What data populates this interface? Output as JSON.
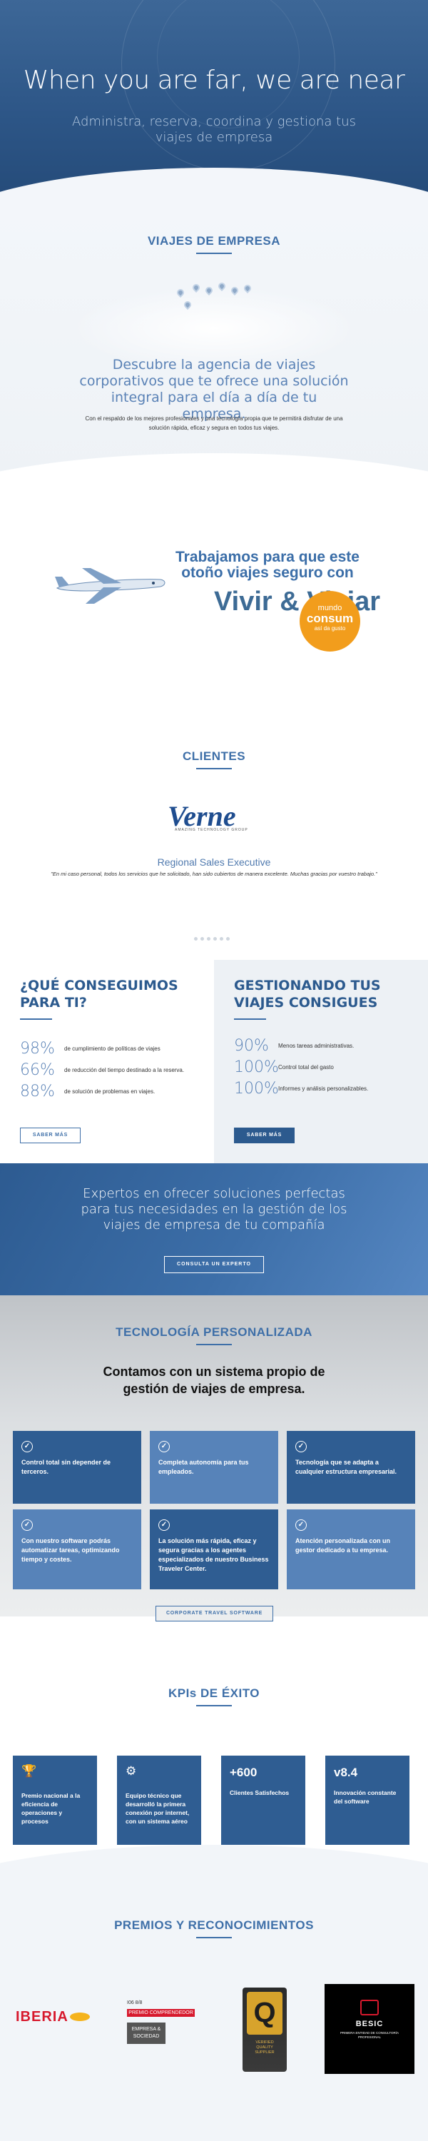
{
  "hero": {
    "title": "When you are far, we are near",
    "subtitle": "Administra, reserva, coordina y gestiona tus viajes de empresa"
  },
  "viajes": {
    "heading": "VIAJES DE EMPRESA",
    "lead": "Descubre la agencia de viajes corporativos que te ofrece una solución integral para el día a día de tu empresa.",
    "body": "Con el respaldo de los mejores profesionales y una tecnología propia que te permitirá disfrutar de una solución rápida, eficaz y segura en todos tus viajes."
  },
  "banner": {
    "line1": "Trabajamos para que este otoño viajes seguro con",
    "line2": "Vivir & Viajar",
    "badge_top": "mundo",
    "badge_brand": "consum",
    "badge_sub": "así da gusto"
  },
  "clientes": {
    "heading": "CLIENTES",
    "logo_text": "Verne",
    "logo_sub": "AMAZING TECHNOLOGY GROUP",
    "role": "Regional Sales Executive",
    "quote": "\"En mi caso personal, todos los servicios que he solicitado, han sido cubiertos de manera excelente. Muchas gracias por vuestro trabajo.\""
  },
  "conseguimos": {
    "heading": "¿QUÉ CONSEGUIMOS PARA TI?",
    "items": [
      {
        "pct": "98%",
        "text": "de cumplimiento de políticas de viajes"
      },
      {
        "pct": "66%",
        "text": "de reducción del tiempo destinado a la reserva."
      },
      {
        "pct": "88%",
        "text": "de solución de problemas en viajes."
      }
    ],
    "button": "SABER MÁS"
  },
  "gestionando": {
    "heading": "GESTIONANDO TUS VIAJES CONSIGUES",
    "items": [
      {
        "pct": "90%",
        "text": "Menos tareas administrativas."
      },
      {
        "pct": "100%",
        "text": "Control total del gasto"
      },
      {
        "pct": "100%",
        "text": "Informes y análisis personalizables."
      }
    ],
    "button": "SABER MÁS"
  },
  "cta": {
    "text": "Expertos en ofrecer soluciones perfectas para tus necesidades en la gestión de los viajes de empresa de tu compañía",
    "button": "CONSULTA UN EXPERTO"
  },
  "tech": {
    "heading": "TECNOLOGÍA PERSONALIZADA",
    "subheading": "Contamos con un sistema propio de gestión de viajes de empresa.",
    "cards": [
      "Control total sin depender de terceros.",
      "Completa autonomía para tus empleados.",
      "Tecnología que se adapta a cualquier estructura empresarial.",
      "Con nuestro software podrás automatizar tareas, optimizando tiempo y costes.",
      "La solución más rápida, eficaz y segura gracias a los agentes especializados de nuestro Business Traveler Center.",
      "Atención personalizada con un gestor dedicado a tu empresa."
    ],
    "button": "CORPORATE TRAVEL SOFTWARE"
  },
  "kpis": {
    "heading": "KPIs DE ÉXITO",
    "items": [
      {
        "big": "",
        "text": "Premio nacional a la eficiencia de operaciones y procesos"
      },
      {
        "big": "",
        "text": "Equipo técnico que desarrolló la primera conexión por internet, con un sistema aéreo"
      },
      {
        "big": "+600",
        "text": "Clientes Satisfechos"
      },
      {
        "big": "v8.4",
        "text": "Innovación constante del software"
      }
    ]
  },
  "premios": {
    "heading": "PREMIOS Y RECONOCIMIENTOS",
    "iberia": "IBERIA",
    "premio_years": "I06      8/8",
    "premio_label": "PREMIO COMPRENDEDOR",
    "premio_sub": "EMPRESA & SOCIEDAD",
    "quality_mark": "Q",
    "quality_text": "VERIFIED QUALITY SUPPLIER",
    "besic_name": "BESIC",
    "besic_sub": "PRIMERA ENTIDAD DE CONSULTORÍA PROFESIONAL"
  },
  "colors": {
    "primary": "#2f5d92",
    "accent": "#3e6fa8",
    "light_card": "#5783b9"
  }
}
